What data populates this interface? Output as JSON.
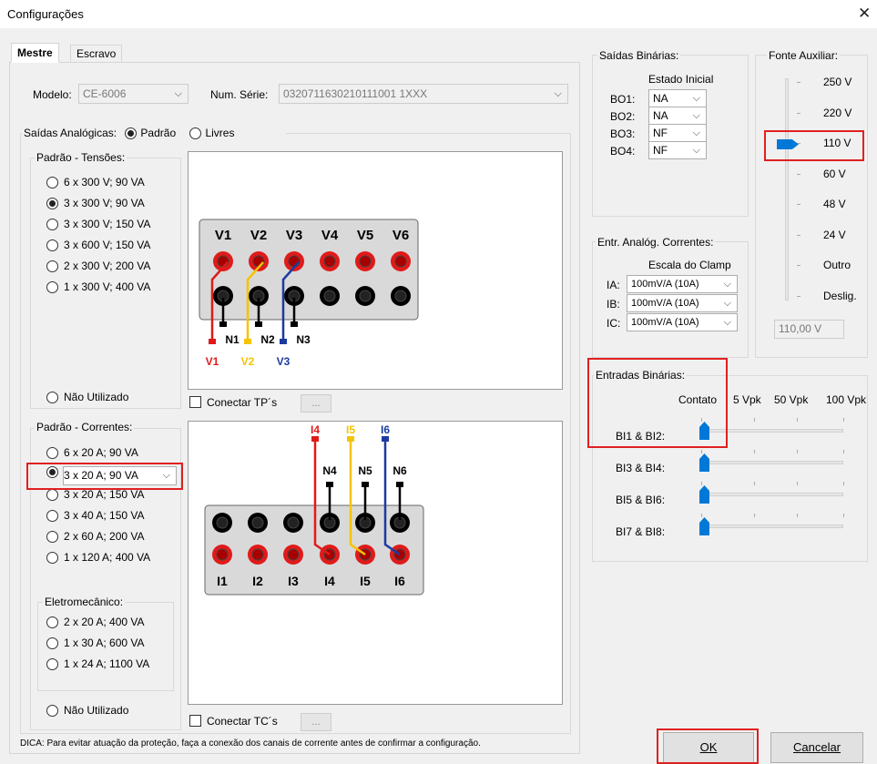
{
  "window": {
    "title": "Configurações"
  },
  "tabs": [
    "Mestre",
    "Escravo"
  ],
  "model": {
    "label": "Modelo:",
    "value": "CE-6006"
  },
  "serial": {
    "label": "Num. Série:",
    "value": "0320711630210111001 1XXX"
  },
  "analog_outputs": {
    "label": "Saídas Analógicas:",
    "opt_padrao": "Padrão",
    "opt_livres": "Livres"
  },
  "voltages": {
    "title": "Padrão - Tensões:",
    "options": [
      "6 x 300 V; 90 VA",
      "3 x 300 V; 90 VA",
      "3 x 300 V; 150 VA",
      "3 x 600 V; 150 VA",
      "2 x 300 V; 200 VA",
      "1 x 300 V; 400 VA"
    ],
    "selected": 1,
    "unused": "Não Utilizado",
    "connect": "Conectar TP´s",
    "ellipsis": "..."
  },
  "currents": {
    "title": "Padrão - Correntes:",
    "options": [
      "6 x 20 A; 90 VA",
      "3 x 20 A; 90 VA",
      "3 x 20 A; 150 VA",
      "3 x 40 A; 150 VA",
      "2 x 60 A; 200 VA",
      "1 x 120 A; 400 VA"
    ],
    "selected": 1,
    "electro_title": "Eletromecânico:",
    "electro": [
      "2 x 20 A; 400 VA",
      "1 x 30 A; 600 VA",
      "1 x 24 A; 1100 VA"
    ],
    "unused": "Não Utilizado",
    "connect": "Conectar TC´s",
    "ellipsis": "..."
  },
  "diagram_v": {
    "heads": [
      "V1",
      "V2",
      "V3",
      "V4",
      "V5",
      "V6"
    ],
    "neutrals": [
      "N1",
      "N2",
      "N3"
    ],
    "wires": [
      "V1",
      "V2",
      "V3"
    ],
    "colors": {
      "red": "#e01a1a",
      "yellow": "#f5c400",
      "blue": "#1c3aa0"
    }
  },
  "diagram_i": {
    "tops": [
      "I4",
      "I5",
      "I6"
    ],
    "neutrals": [
      "N4",
      "N5",
      "N6"
    ],
    "heads": [
      "I1",
      "I2",
      "I3",
      "I4",
      "I5",
      "I6"
    ]
  },
  "binary_outputs": {
    "title": "Saídas Binárias:",
    "header": "Estado Inicial",
    "items": [
      {
        "label": "BO1:",
        "value": "NA"
      },
      {
        "label": "BO2:",
        "value": "NA"
      },
      {
        "label": "BO3:",
        "value": "NF"
      },
      {
        "label": "BO4:",
        "value": "NF"
      }
    ]
  },
  "aux_source": {
    "title": "Fonte Auxiliar:",
    "levels": [
      "250 V",
      "220 V",
      "110 V",
      "60 V",
      "48 V",
      "24 V",
      "Outro",
      "Deslig."
    ],
    "selected": "110 V",
    "readout": "110,00 V"
  },
  "analog_currents": {
    "title": "Entr. Analóg. Correntes:",
    "header": "Escala do Clamp",
    "items": [
      {
        "label": "IA:",
        "value": "100mV/A (10A)"
      },
      {
        "label": "IB:",
        "value": "100mV/A (10A)"
      },
      {
        "label": "IC:",
        "value": "100mV/A (10A)"
      }
    ]
  },
  "binary_inputs": {
    "title": "Entradas Binárias:",
    "scale": [
      "Contato",
      "5 Vpk",
      "50 Vpk",
      "100 Vpk"
    ],
    "items": [
      {
        "label": "BI1 & BI2:",
        "level": "Contato"
      },
      {
        "label": "BI3 & BI4:",
        "level": "Contato"
      },
      {
        "label": "BI5 & BI6:",
        "level": "Contato"
      },
      {
        "label": "BI7 & BI8:",
        "level": "Contato"
      }
    ]
  },
  "tip": "DICA: Para evitar atuação da proteção, faça a conexão dos canais de corrente antes de confirmar a configuração.",
  "buttons": {
    "ok": "OK",
    "cancel": "Cancelar"
  }
}
